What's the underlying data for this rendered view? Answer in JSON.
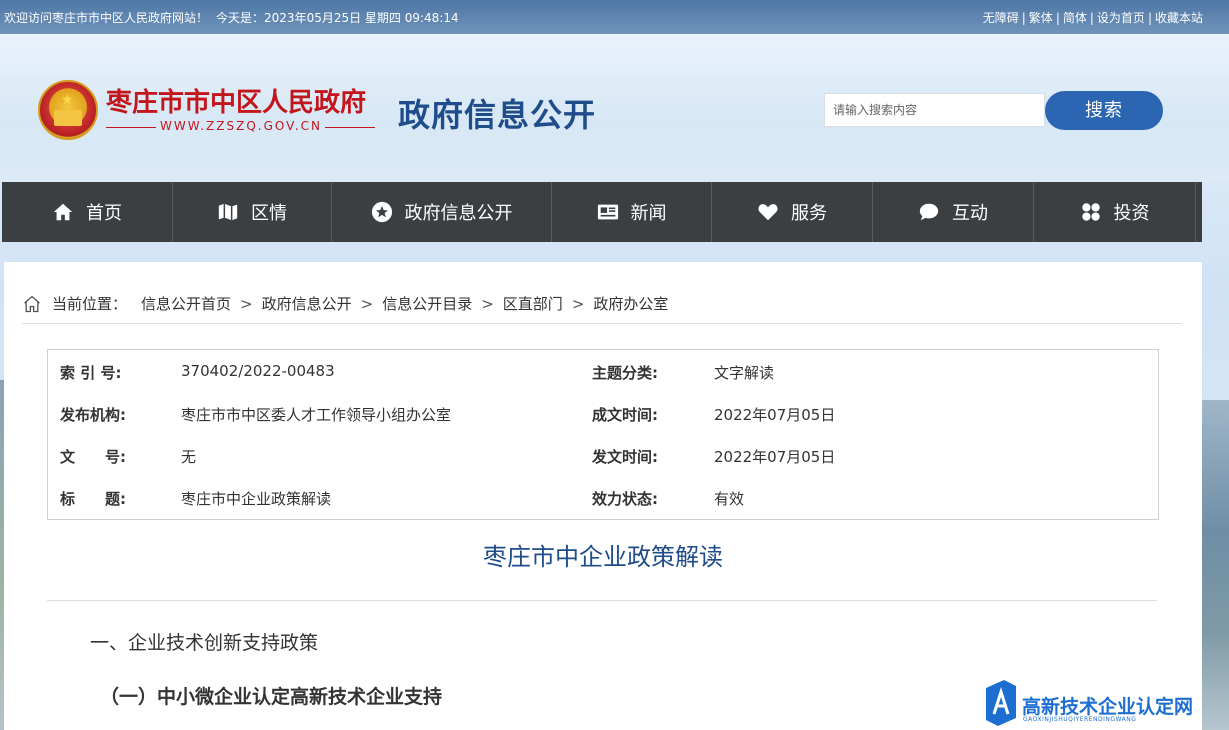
{
  "topbar": {
    "welcome": "欢迎访问枣庄市市中区人民政府网站！",
    "date_prefix": "今天是：",
    "datetime": "2023年05月25日 星期四 09:48:14",
    "links": [
      "无障碍",
      "繁体",
      "简体",
      "设为首页",
      "收藏本站"
    ]
  },
  "header": {
    "site_title": "枣庄市市中区人民政府",
    "site_url": "WWW.ZZSZQ.GOV.CN",
    "section_title": "政府信息公开",
    "search_placeholder": "请输入搜索内容",
    "search_button": "搜索"
  },
  "nav": {
    "items": [
      {
        "label": "首页",
        "icon": "home-icon"
      },
      {
        "label": "区情",
        "icon": "map-icon"
      },
      {
        "label": "政府信息公开",
        "icon": "star-icon"
      },
      {
        "label": "新闻",
        "icon": "newspaper-icon"
      },
      {
        "label": "服务",
        "icon": "heart-icon"
      },
      {
        "label": "互动",
        "icon": "chat-icon"
      },
      {
        "label": "投资",
        "icon": "grid-icon"
      }
    ]
  },
  "breadcrumb": {
    "prefix": "当前位置：",
    "items": [
      "信息公开首页",
      "政府信息公开",
      "信息公开目录",
      "区直部门",
      "政府办公室"
    ],
    "separator": ">"
  },
  "meta": {
    "index_label": "索 引 号:",
    "index_value": "370402/2022-00483",
    "topic_label": "主题分类:",
    "topic_value": "文字解读",
    "publisher_label": "发布机构:",
    "publisher_value": "枣庄市市中区委人才工作领导小组办公室",
    "created_label": "成文时间:",
    "created_value": "2022年07月05日",
    "docno_label": "文　　号:",
    "docno_value": "无",
    "issued_label": "发文时间:",
    "issued_value": "2022年07月05日",
    "title_label": "标　　题:",
    "title_value": "枣庄市中企业政策解读",
    "status_label": "效力状态:",
    "status_value": "有效"
  },
  "article": {
    "title": "枣庄市中企业政策解读",
    "heading1": "一、企业技术创新支持政策",
    "heading2": "（一）中小微企业认定高新技术企业支持"
  },
  "watermark": {
    "text": "高新技术企业认定网",
    "sub": "GAOXINJISHUQIYERENDINGWANG"
  },
  "colors": {
    "topbar": "#5b7fa8",
    "nav_bg": "#3c3f42",
    "title_blue": "#1f4c8a",
    "brand_red": "#c3161c",
    "search_button": "#2c66b3"
  }
}
